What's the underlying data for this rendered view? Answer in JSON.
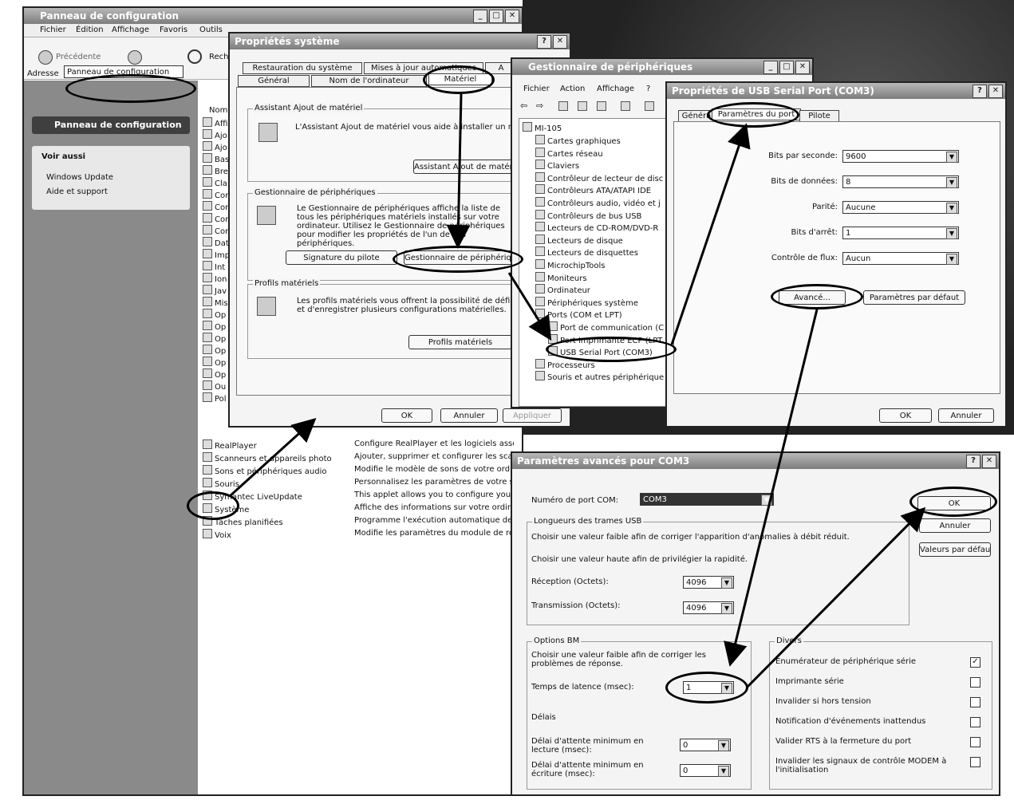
{
  "control_panel": {
    "title": "Panneau de configuration",
    "menu": [
      "Fichier",
      "Édition",
      "Affichage",
      "Favoris",
      "Outils"
    ],
    "back": "Précédente",
    "search": "Reche",
    "address_label": "Adresse",
    "address_value": "Panneau de configuration",
    "panel_header": "Panneau de configuration",
    "see_also": "Voir aussi",
    "see_also_items": [
      "Windows Update",
      "Aide et support"
    ],
    "col_name": "Nom",
    "short_items": [
      "Affi",
      "Ajo",
      "Ajo",
      "Bas",
      "Bre",
      "Cla",
      "Cor",
      "Cor",
      "Cor",
      "Cor",
      "Dat",
      "Imp",
      "Int",
      "Ion",
      "Jav",
      "Mis",
      "Op",
      "Op",
      "Op",
      "Op",
      "Op",
      "Op",
      "Ou",
      "Pol"
    ],
    "items": [
      "RealPlayer",
      "Scanneurs et appareils photo",
      "Sons et périphériques audio",
      "Souris",
      "Symantec LiveUpdate",
      "Système",
      "Tâches planifiées",
      "Voix"
    ],
    "descriptions": [
      "Configure RealPlayer et les logiciels associé",
      "Ajouter, supprimer et configurer les scann",
      "Modifie le modèle de sons de votre ordinat",
      "Personnalisez les paramètres de votre sou",
      "This applet allows you to configure your Li",
      "Affiche des informations sur votre ordinate",
      "Programme l'exécution automatique de tâc",
      "Modifie les paramètres du module de recor"
    ]
  },
  "system_props": {
    "title": "Propriétés système",
    "tabs_row1": [
      "Restauration du système",
      "Mises à jour automatiques",
      "A"
    ],
    "tabs_row2": [
      "Général",
      "Nom de l'ordinateur",
      "Matériel"
    ],
    "g1_title": "Assistant Ajout de matériel",
    "g1_text": "L'Assistant Ajout de matériel vous aide à installer un matériel.",
    "g1_btn": "Assistant Ajout de matériel",
    "g2_title": "Gestionnaire de périphériques",
    "g2_text": "Le Gestionnaire de périphériques affiche la liste de tous les périphériques matériels installés sur votre ordinateur. Utilisez le Gestionnaire de périphériques pour modifier les propriétés de l'un de ces périphériques.",
    "g2_btn1": "Signature du pilote",
    "g2_btn2": "Gestionnaire de périphériques",
    "g3_title": "Profils matériels",
    "g3_text": "Les profils matériels vous offrent la possibilité de définir et d'enregistrer plusieurs configurations matérielles.",
    "g3_btn": "Profils matériels",
    "ok": "OK",
    "cancel": "Annuler",
    "apply": "Appliquer"
  },
  "device_manager": {
    "title": "Gestionnaire de périphériques",
    "menu": [
      "Fichier",
      "Action",
      "Affichage",
      "?"
    ],
    "root": "MI-105",
    "nodes": [
      "Cartes graphiques",
      "Cartes réseau",
      "Claviers",
      "Contrôleur de lecteur de disc",
      "Contrôleurs ATA/ATAPI IDE",
      "Contrôleurs audio, vidéo et j",
      "Contrôleurs de bus USB",
      "Lecteurs de CD-ROM/DVD-R",
      "Lecteurs de disque",
      "Lecteurs de disquettes",
      "MicrochipTools",
      "Moniteurs",
      "Ordinateur",
      "Périphériques système",
      "Ports (COM et LPT)",
      "Port de communication (C",
      "Port imprimante ECP (LPT",
      "USB Serial Port (COM3)",
      "Processeurs",
      "Souris et autres périphérique"
    ]
  },
  "usb_props": {
    "title": "Propriétés de USB Serial Port (COM3)",
    "tabs": [
      "Généra",
      "Paramètres du port",
      "Pilote"
    ],
    "fields": [
      {
        "label": "Bits par seconde:",
        "value": "9600"
      },
      {
        "label": "Bits de données:",
        "value": "8"
      },
      {
        "label": "Parité:",
        "value": "Aucune"
      },
      {
        "label": "Bits d'arrêt:",
        "value": "1"
      },
      {
        "label": "Contrôle de flux:",
        "value": "Aucun"
      }
    ],
    "advanced": "Avancé...",
    "defaults": "Paramètres par défaut",
    "ok": "OK",
    "cancel": "Annuler"
  },
  "adv": {
    "title": "Paramètres avancés pour COM3",
    "port_label": "Numéro de port COM:",
    "port_value": "COM3",
    "ok": "OK",
    "cancel": "Annuler",
    "defaults": "Valeurs par défaut",
    "usb_group": "Longueurs des trames USB",
    "usb_text1": "Choisir une valeur faible afin de corriger l'apparition d'anomalies à débit réduit.",
    "usb_text2": "Choisir une valeur haute afin de privilégier la rapidité.",
    "rx_label": "Réception (Octets):",
    "rx_value": "4096",
    "tx_label": "Transmission (Octets):",
    "tx_value": "4096",
    "bm_group": "Options BM",
    "bm_text": "Choisir une valeur faible afin de corriger les problèmes de réponse.",
    "latency_label": "Temps de latence (msec):",
    "latency_value": "1",
    "delays": "Délais",
    "read_label": "Délai d'attente minimum en lecture (msec):",
    "read_value": "0",
    "write_label": "Délai d'attente minimum en écriture (msec):",
    "write_value": "0",
    "misc_group": "Divers",
    "misc_items": [
      {
        "label": "Enumérateur de périphérique série",
        "checked": true
      },
      {
        "label": "Imprimante série",
        "checked": false
      },
      {
        "label": "Invalider si hors tension",
        "checked": false
      },
      {
        "label": "Notification d'événements inattendus",
        "checked": false
      },
      {
        "label": "Valider RTS à la fermeture du port",
        "checked": false
      },
      {
        "label": "Invalider les signaux de contrôle MODEM à l'initialisation",
        "checked": false
      }
    ]
  }
}
